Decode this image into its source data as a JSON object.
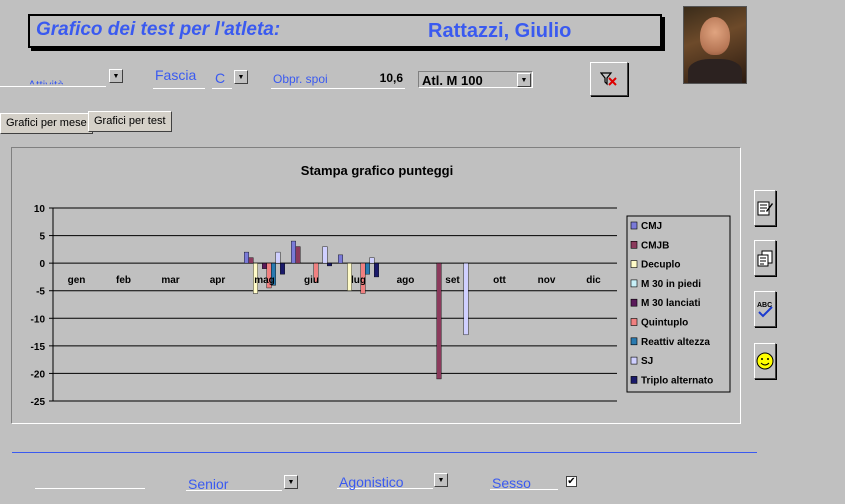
{
  "header": {
    "title_label": "Grafico dei test per l'atleta:",
    "athlete_name": "Rattazzi, Giulio"
  },
  "filters": {
    "first_select_value": "Attività",
    "fascia_label": "Fascia",
    "fascia_value": "C",
    "obpr_label": "Obpr. spoi",
    "obpr_value": "10,6",
    "category_value": "Atl. M 100"
  },
  "tabs": [
    {
      "label": "Grafici per mese"
    },
    {
      "label": "Grafici per test"
    }
  ],
  "bottom": {
    "category_value": "Senior",
    "level_value": "Agonistico",
    "sex_label": "Sesso",
    "sex_checked": "✔"
  },
  "side_buttons": [
    {
      "icon": "edit-doc-icon"
    },
    {
      "icon": "copy-doc-icon"
    },
    {
      "icon": "spellcheck-icon"
    },
    {
      "icon": "smiley-icon"
    }
  ],
  "chart_data": {
    "type": "bar",
    "title": "Stampa grafico punteggi",
    "categories": [
      "gen",
      "feb",
      "mar",
      "apr",
      "mag",
      "giu",
      "lug",
      "ago",
      "set",
      "ott",
      "nov",
      "dic"
    ],
    "ylim": [
      -25,
      10
    ],
    "yticks": [
      10,
      5,
      0,
      -5,
      -10,
      -15,
      -20,
      -25
    ],
    "grid": true,
    "legend_position": "right",
    "series": [
      {
        "name": "CMJ",
        "color": "#7a7ad8",
        "values": [
          null,
          null,
          null,
          null,
          2,
          4,
          1.5,
          null,
          null,
          null,
          null,
          null
        ]
      },
      {
        "name": "CMJB",
        "color": "#8b3a5c",
        "values": [
          null,
          null,
          null,
          null,
          1,
          3,
          null,
          null,
          -21,
          null,
          null,
          null
        ]
      },
      {
        "name": "Decuplo",
        "color": "#fffbc8",
        "values": [
          null,
          null,
          null,
          null,
          -5.5,
          null,
          -5,
          null,
          null,
          null,
          null,
          null
        ]
      },
      {
        "name": "M 30 in piedi",
        "color": "#c8f0f8",
        "values": [
          null,
          null,
          null,
          null,
          null,
          null,
          null,
          null,
          null,
          null,
          null,
          null
        ]
      },
      {
        "name": "M 30 lanciati",
        "color": "#5a1a5a",
        "values": [
          null,
          null,
          null,
          null,
          -1,
          null,
          null,
          null,
          null,
          null,
          null,
          null
        ]
      },
      {
        "name": "Quintuplo",
        "color": "#f08080",
        "values": [
          null,
          null,
          null,
          null,
          -4.5,
          -3.5,
          -5.5,
          null,
          null,
          null,
          null,
          null
        ]
      },
      {
        "name": "Reattiv altezza",
        "color": "#2a7ab0",
        "values": [
          null,
          null,
          null,
          null,
          -4,
          null,
          -2,
          null,
          null,
          null,
          null,
          null
        ]
      },
      {
        "name": "SJ",
        "color": "#d0d0ff",
        "values": [
          null,
          null,
          null,
          null,
          2,
          3,
          1,
          null,
          -13,
          null,
          null,
          null
        ]
      },
      {
        "name": "Triplo alternato",
        "color": "#1a1a6a",
        "values": [
          null,
          null,
          null,
          null,
          -2,
          -0.5,
          -2.5,
          null,
          null,
          null,
          null,
          null
        ]
      }
    ]
  }
}
